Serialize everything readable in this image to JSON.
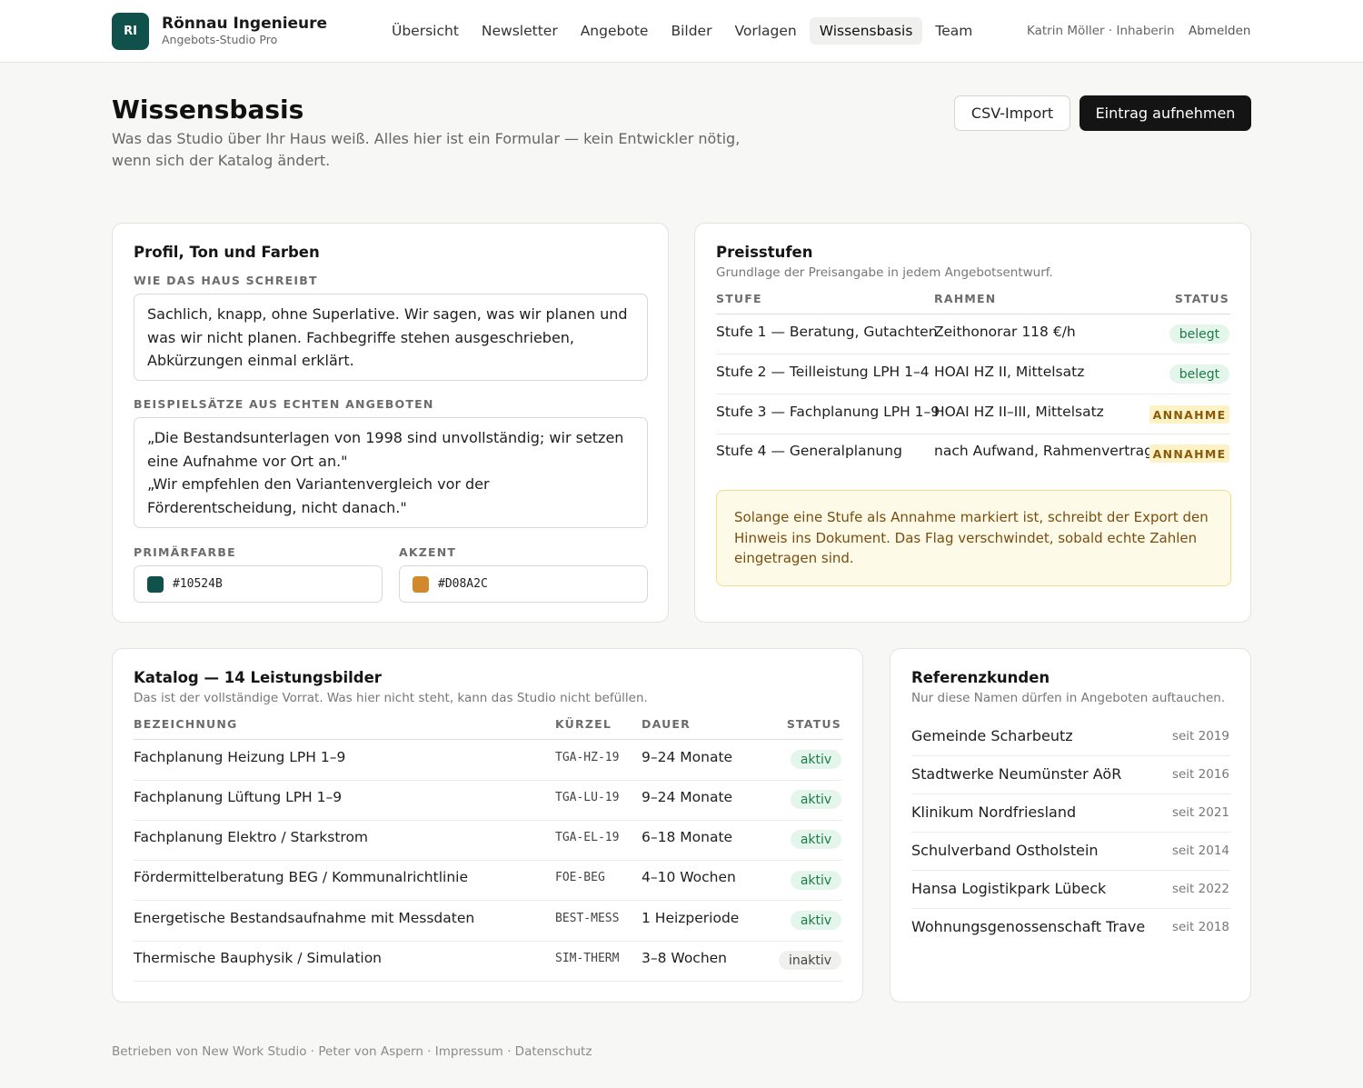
{
  "header": {
    "logo_initials": "RI",
    "brand_name": "Rönnau Ingenieure",
    "brand_sub": "Angebots-Studio Pro",
    "nav": [
      "Übersicht",
      "Newsletter",
      "Angebote",
      "Bilder",
      "Vorlagen",
      "Wissensbasis",
      "Team"
    ],
    "active_nav": "Wissensbasis",
    "user": "Katrin Möller · Inhaberin",
    "logout": "Abmelden"
  },
  "page": {
    "title": "Wissensbasis",
    "description": "Was das Studio über Ihr Haus weiß. Alles hier ist ein Formular — kein Entwickler nötig, wenn sich der Katalog ändert.",
    "csv_import": "CSV-Import",
    "add_entry": "Eintrag aufnehmen"
  },
  "profile": {
    "title": "Profil, Ton und Farben",
    "tone_label": "WIE DAS HAUS SCHREIBT",
    "tone_text": "Sachlich, knapp, ohne Superlative. Wir sagen, was wir planen und was wir nicht planen. Fachbegriffe stehen ausgeschrieben, Abkürzungen einmal erklärt.",
    "examples_label": "BEISPIELSÄTZE AUS ECHTEN ANGEBOTEN",
    "example_1": "„Die Bestandsunterlagen von 1998 sind unvollständig; wir setzen eine Aufnahme vor Ort an.\"",
    "example_2": "„Wir empfehlen den Variantenvergleich vor der Förderentscheidung, nicht danach.\"",
    "primary_label": "PRIMÄRFARBE",
    "primary_color": "#10524B",
    "accent_label": "AKZENT",
    "accent_color": "#D08A2C"
  },
  "pricing": {
    "title": "Preisstufen",
    "subtitle": "Grundlage der Preisangabe in jedem Angebotsentwurf.",
    "col_stufe": "STUFE",
    "col_rahmen": "RAHMEN",
    "col_status": "STATUS",
    "rows": [
      {
        "stufe": "Stufe 1 — Beratung, Gutachten",
        "rahmen": "Zeithonorar 118 €/h",
        "status": "belegt",
        "type": "ok"
      },
      {
        "stufe": "Stufe 2 — Teilleistung LPH 1–4",
        "rahmen": "HOAI HZ II, Mittelsatz",
        "status": "belegt",
        "type": "ok"
      },
      {
        "stufe": "Stufe 3 — Fachplanung LPH 1–9",
        "rahmen": "HOAI HZ II–III, Mittelsatz",
        "status": "ANNAHME",
        "type": "warn"
      },
      {
        "stufe": "Stufe 4 — Generalplanung",
        "rahmen": "nach Aufwand, Rahmenvertrag",
        "status": "ANNAHME",
        "type": "warn"
      }
    ],
    "note": "Solange eine Stufe als Annahme markiert ist, schreibt der Export den Hinweis ins Dokument. Das Flag verschwindet, sobald echte Zahlen eingetragen sind."
  },
  "catalog": {
    "title": "Katalog — 14 Leistungsbilder",
    "subtitle": "Das ist der vollständige Vorrat. Was hier nicht steht, kann das Studio nicht befüllen.",
    "col_name": "BEZEICHNUNG",
    "col_code": "KÜRZEL",
    "col_duration": "DAUER",
    "col_status": "STATUS",
    "rows": [
      {
        "name": "Fachplanung Heizung LPH 1–9",
        "code": "TGA-HZ-19",
        "duration": "9–24 Monate",
        "status": "aktiv"
      },
      {
        "name": "Fachplanung Lüftung LPH 1–9",
        "code": "TGA-LU-19",
        "duration": "9–24 Monate",
        "status": "aktiv"
      },
      {
        "name": "Fachplanung Elektro / Starkstrom",
        "code": "TGA-EL-19",
        "duration": "6–18 Monate",
        "status": "aktiv"
      },
      {
        "name": "Fördermittelberatung BEG / Kommunalrichtlinie",
        "code": "FOE-BEG",
        "duration": "4–10 Wochen",
        "status": "aktiv"
      },
      {
        "name": "Energetische Bestandsaufnahme mit Messdaten",
        "code": "BEST-MESS",
        "duration": "1 Heizperiode",
        "status": "aktiv"
      },
      {
        "name": "Thermische Bauphysik / Simulation",
        "code": "SIM-THERM",
        "duration": "3–8 Wochen",
        "status": "inaktiv"
      }
    ]
  },
  "references": {
    "title": "Referenzkunden",
    "subtitle": "Nur diese Namen dürfen in Angeboten auftauchen.",
    "rows": [
      {
        "name": "Gemeinde Scharbeutz",
        "since": "seit 2019"
      },
      {
        "name": "Stadtwerke Neumünster AöR",
        "since": "seit 2016"
      },
      {
        "name": "Klinikum Nordfriesland",
        "since": "seit 2021"
      },
      {
        "name": "Schulverband Ostholstein",
        "since": "seit 2014"
      },
      {
        "name": "Hansa Logistikpark Lübeck",
        "since": "seit 2022"
      },
      {
        "name": "Wohnungsgenossenschaft Trave",
        "since": "seit 2018"
      }
    ]
  },
  "footer": "Betrieben von New Work Studio · Peter von Aspern · Impressum · Datenschutz"
}
